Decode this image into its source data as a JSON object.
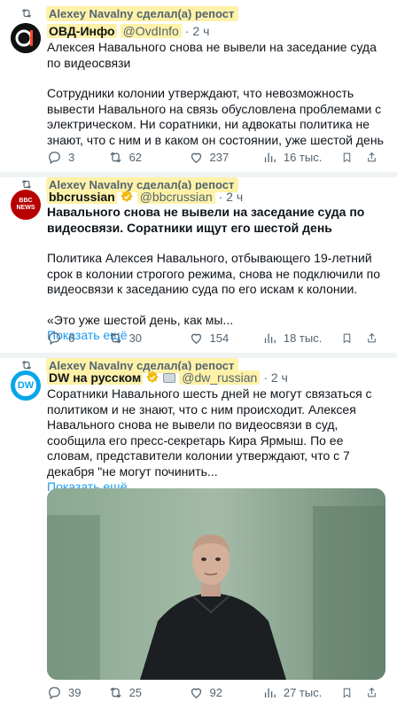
{
  "tweets": [
    {
      "repost_label": "Alexey Navalny сделал(а) репост",
      "author": "ОВД-Инфо",
      "handle": "@OvdInfo",
      "time": "· 2 ч",
      "paragraphs": [
        "Алексея Навального снова не вывели на заседание суда по видеосвязи",
        "Сотрудники колонии утверждают, что невозможность вывести Навального на связь обусловлена проблемами с электрическом. Ни соратники, ни адвокаты политика не знают, что с ним и в каком он состоянии, уже шестой день"
      ],
      "stats": {
        "replies": "3",
        "reposts": "62",
        "likes": "237",
        "views": "16 тыс."
      }
    },
    {
      "repost_label": "Alexey Navalny сделал(а) репост",
      "author": "bbcrussian",
      "handle": "@bbcrussian",
      "time": "· 2 ч",
      "avatar_text": "BBC NEWS",
      "headline": "Навального снова не вывели на заседание суда по видеосвязи. Соратники ищут его шестой день",
      "paragraphs": [
        "Политика Алексея Навального, отбывающего 19-летний срок в колонии строгого режима, снова не подключили по видеосвязи к заседанию суда по его искам к колонии.",
        "«Это уже шестой день, как мы..."
      ],
      "show_more": "Показать ещё",
      "stats": {
        "replies": "6",
        "reposts": "30",
        "likes": "154",
        "views": "18 тыс."
      }
    },
    {
      "repost_label": "Alexey Navalny сделал(а) репост",
      "author": "DW на русском",
      "handle": "@dw_russian",
      "time": "· 2 ч",
      "avatar_text": "DW",
      "paragraphs": [
        "Соратники Навального шесть дней не могут связаться с политиком и не знают, что с ним происходит. Алексея Навального снова не вывели по видеосвязи в суд, сообщила его пресс-секретарь Кира Ярмыш. По ее словам, представители колонии утверждают, что с 7 декабря \"не могут починить..."
      ],
      "show_more": "Показать ещё",
      "stats": {
        "replies": "39",
        "reposts": "25",
        "likes": "92",
        "views": "27 тыс."
      }
    }
  ],
  "colors": {
    "highlight": "#fff2a8",
    "link": "#1d9bf0",
    "muted": "#536471",
    "verified": "#f2b90d",
    "separator": "#eff3f4"
  },
  "icons": [
    "repost-icon",
    "reply-icon",
    "like-icon",
    "views-icon",
    "bookmark-icon",
    "share-icon",
    "verified-badge-icon",
    "flag-icon"
  ]
}
